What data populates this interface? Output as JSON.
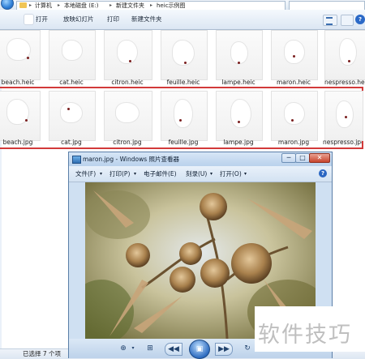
{
  "explorer": {
    "breadcrumb": [
      "计算机",
      "本地磁盘 (E:)",
      "新建文件夹",
      "heic示例图"
    ],
    "toolbar": {
      "open": "打开",
      "slideshow": "放映幻灯片",
      "print": "打印",
      "new_folder": "新建文件夹"
    },
    "heic_files": [
      "beach.heic",
      "cat.heic",
      "citron.heic",
      "feuille.heic",
      "lampe.heic",
      "maron.heic",
      "nespresso.heic"
    ],
    "jpg_files": [
      "beach.jpg",
      "cat.jpg",
      "citron.jpg",
      "feuille.jpg",
      "lampe.jpg",
      "maron.jpg",
      "nespresso.jpg"
    ],
    "status": "已选择 7 个项"
  },
  "viewer": {
    "title": "maron.jpg - Windows 照片查看器",
    "menu": {
      "file": "文件(F)",
      "print": "打印(P)",
      "email": "电子邮件(E)",
      "burn": "刻录(U)",
      "open": "打开(O)"
    },
    "window_buttons": {
      "minimize": "─",
      "maximize": "□",
      "close": "✕"
    },
    "controls": {
      "zoom": "⊕",
      "fit": "⊞",
      "prev": "◀◀",
      "slideshow": "▣",
      "next": "▶▶",
      "rotate": "↻"
    }
  },
  "watermark": "软件技巧"
}
